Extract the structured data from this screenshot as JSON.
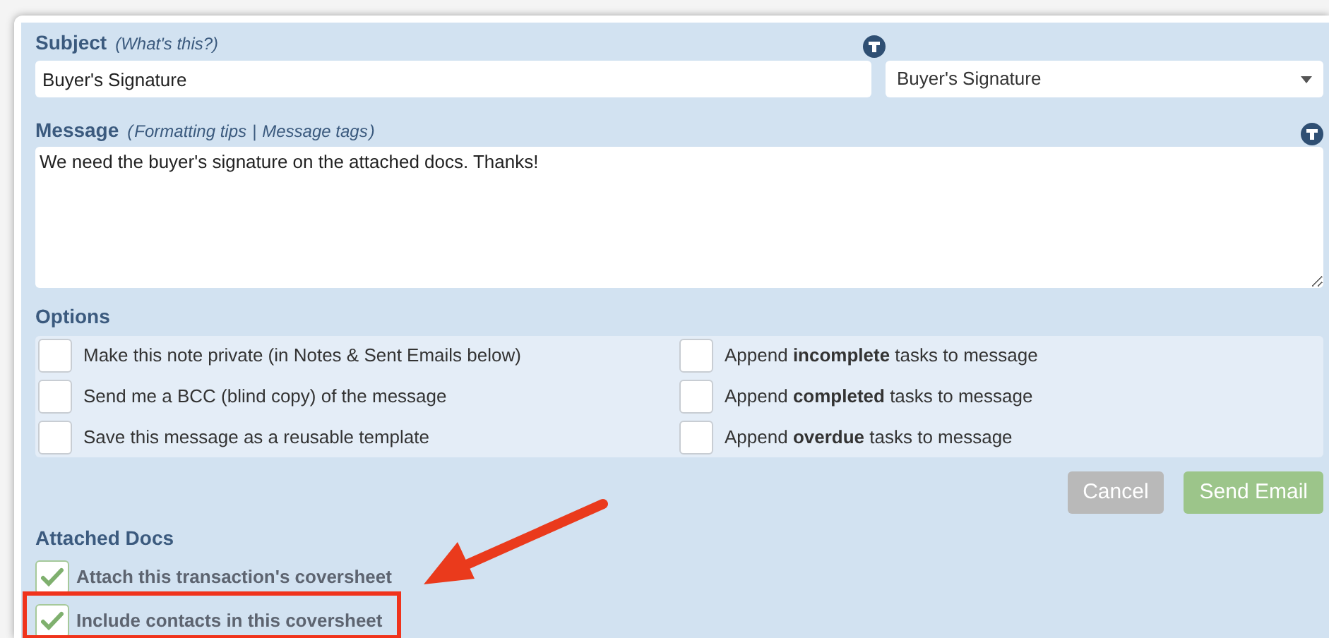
{
  "subject": {
    "label": "Subject",
    "hint": "(What's this?)",
    "value": "Buyer's Signature",
    "template": "Buyer's Signature"
  },
  "message": {
    "label": "Message",
    "hint_open": "(",
    "links": [
      "Formatting tips",
      "Message tags"
    ],
    "separator": "|",
    "hint_close": ")",
    "value": "We need the buyer's signature on the attached docs. Thanks!"
  },
  "options": {
    "label": "Options",
    "items": [
      {
        "text": "Make this note private (in Notes & Sent Emails below)",
        "checked": false
      },
      {
        "text": "Append **incomplete** tasks to message",
        "checked": false
      },
      {
        "text": "Send me a BCC (blind copy) of the message",
        "checked": false
      },
      {
        "text": "Append **completed** tasks to message",
        "checked": false
      },
      {
        "text": "Save this message as a reusable template",
        "checked": false
      },
      {
        "text": "Append **overdue** tasks to message",
        "checked": false
      }
    ]
  },
  "buttons": [
    {
      "label": "Cancel",
      "kind": "cancel"
    },
    {
      "label": "Send Email",
      "kind": "primary"
    }
  ],
  "attached_docs": {
    "label": "Attached Docs",
    "items": [
      {
        "text": "Attach this transaction's coversheet",
        "checked": true
      },
      {
        "text": "Include contacts in this coversheet",
        "checked": true
      }
    ]
  }
}
